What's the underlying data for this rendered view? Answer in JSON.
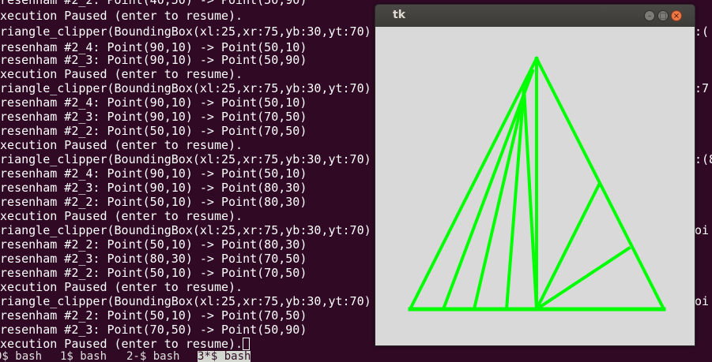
{
  "terminal": {
    "lines": [
      "Bresenham #2_2: Point(40,50) -> Point(50,90)",
      "Execution Paused (enter to resume).",
      "triangle_clipper(BoundingBox(xl:25,xr:75,yb:30,yt:70)",
      "Bresenham #2_4: Point(90,10) -> Point(50,10)",
      "Bresenham #2_3: Point(90,10) -> Point(50,90)",
      "Execution Paused (enter to resume).",
      "triangle_clipper(BoundingBox(xl:25,xr:75,yb:30,yt:70)",
      "Bresenham #2_4: Point(90,10) -> Point(50,10)",
      "Bresenham #2_3: Point(90,10) -> Point(70,50)",
      "Bresenham #2_2: Point(50,10) -> Point(70,50)",
      "Execution Paused (enter to resume).",
      "triangle_clipper(BoundingBox(xl:25,xr:75,yb:30,yt:70)",
      "Bresenham #2_4: Point(90,10) -> Point(50,10)",
      "Bresenham #2_3: Point(90,10) -> Point(80,30)",
      "Bresenham #2_2: Point(50,10) -> Point(80,30)",
      "Execution Paused (enter to resume).",
      "triangle_clipper(BoundingBox(xl:25,xr:75,yb:30,yt:70)",
      "Bresenham #2_2: Point(50,10) -> Point(80,30)",
      "Bresenham #2_3: Point(80,30) -> Point(70,50)",
      "Bresenham #2_2: Point(50,10) -> Point(70,50)",
      "Execution Paused (enter to resume).",
      "triangle_clipper(BoundingBox(xl:25,xr:75,yb:30,yt:70)",
      "Bresenham #2_2: Point(50,10) -> Point(70,50)",
      "Bresenham #2_3: Point(70,50) -> Point(50,90)",
      "Execution Paused (enter to resume)."
    ],
    "right_fragments": [
      ":(",
      ":7",
      ":(8",
      "oi",
      "oi"
    ]
  },
  "status_bar": {
    "tabs": [
      "0$ bash",
      "1$ bash",
      "2-$ bash",
      "3*$ bash"
    ],
    "active_index": 3
  },
  "tk_window": {
    "title": "tk",
    "minimize_glyph": "–",
    "maximize_glyph": "□",
    "close_glyph": "×",
    "line_color": "#00ff00",
    "canvas_color": "#d9d9d9"
  }
}
